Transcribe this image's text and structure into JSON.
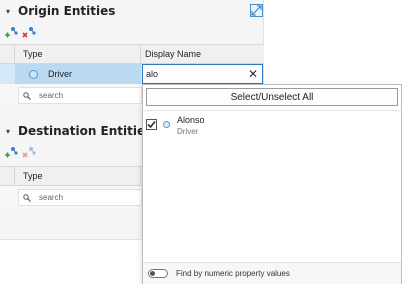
{
  "origin": {
    "title": "Origin Entities",
    "columns": {
      "type": "Type",
      "name": "Display Name"
    },
    "selected_row": {
      "type": "Driver",
      "name_value": "alo"
    },
    "search_placeholder": "search"
  },
  "destination": {
    "title": "Destination Entities",
    "columns": {
      "type": "Type"
    },
    "search_placeholder": "search"
  },
  "dropdown": {
    "select_all_label": "Select/Unselect All",
    "items": [
      {
        "name": "Alonso",
        "type": "Driver",
        "checked": true
      }
    ],
    "footer_label": "Find by numeric property values"
  },
  "colors": {
    "accent": "#2b79c2",
    "selection": "#d6e9f8",
    "add_icon": "#3a7fc1",
    "remove_icon": "#d23b2e"
  },
  "icons": [
    "chevron-down-icon",
    "expand-panel-icon",
    "add-entity-icon",
    "remove-entity-icon",
    "entity-type-icon",
    "search-icon",
    "clear-icon",
    "check-icon",
    "toggle-icon"
  ]
}
